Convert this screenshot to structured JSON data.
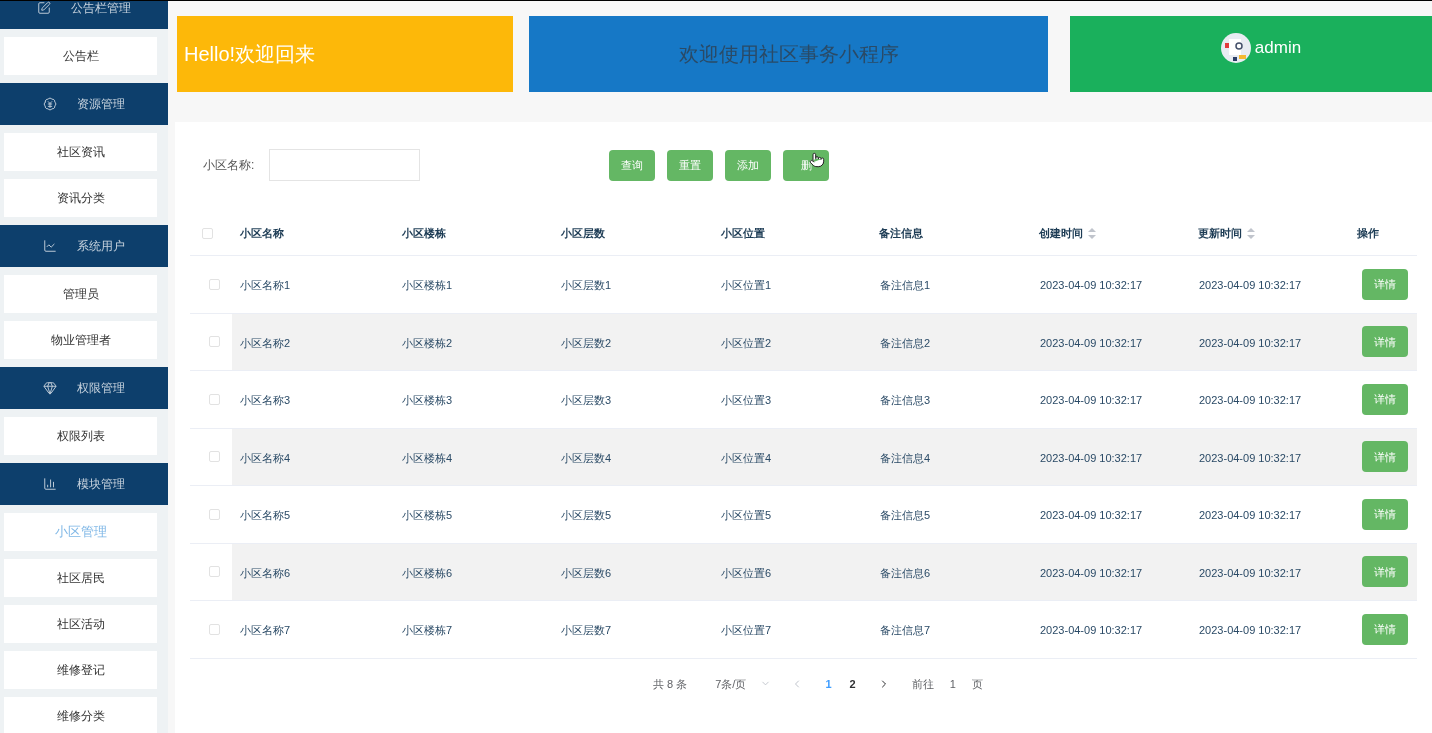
{
  "sidebar": {
    "groups": [
      {
        "title": "公告栏管理",
        "items": [
          {
            "label": "公告栏",
            "selected": false
          }
        ]
      },
      {
        "title": "资源管理",
        "items": [
          {
            "label": "社区资讯",
            "selected": false
          },
          {
            "label": "资讯分类",
            "selected": false
          }
        ]
      },
      {
        "title": "系统用户",
        "items": [
          {
            "label": "管理员",
            "selected": false
          },
          {
            "label": "物业管理者",
            "selected": false
          }
        ]
      },
      {
        "title": "权限管理",
        "items": [
          {
            "label": "权限列表",
            "selected": false
          }
        ]
      },
      {
        "title": "模块管理",
        "items": [
          {
            "label": "小区管理",
            "selected": true
          },
          {
            "label": "社区居民",
            "selected": false
          },
          {
            "label": "社区活动",
            "selected": false
          },
          {
            "label": "维修登记",
            "selected": false
          },
          {
            "label": "维修分类",
            "selected": false
          }
        ]
      }
    ]
  },
  "banners": {
    "greeting": "Hello!欢迎回来",
    "welcome": "欢迎使用社区事务小程序",
    "user": "admin"
  },
  "search": {
    "label": "小区名称:",
    "buttons": [
      "查询",
      "重置",
      "添加",
      "删"
    ]
  },
  "table": {
    "all_checked": false,
    "columns": [
      {
        "label": "小区名称",
        "sortable": false
      },
      {
        "label": "小区楼栋",
        "sortable": false
      },
      {
        "label": "小区层数",
        "sortable": false
      },
      {
        "label": "小区位置",
        "sortable": false
      },
      {
        "label": "备注信息",
        "sortable": false
      },
      {
        "label": "创建时间",
        "sortable": true
      },
      {
        "label": "更新时间",
        "sortable": true
      },
      {
        "label": "操作",
        "sortable": false
      }
    ],
    "rows": [
      {
        "cells": [
          "小区名称1",
          "小区楼栋1",
          "小区层数1",
          "小区位置1",
          "备注信息1",
          "2023-04-09 10:32:17",
          "2023-04-09 10:32:17"
        ],
        "action": "详情",
        "checked": false
      },
      {
        "cells": [
          "小区名称2",
          "小区楼栋2",
          "小区层数2",
          "小区位置2",
          "备注信息2",
          "2023-04-09 10:32:17",
          "2023-04-09 10:32:17"
        ],
        "action": "详情",
        "checked": false
      },
      {
        "cells": [
          "小区名称3",
          "小区楼栋3",
          "小区层数3",
          "小区位置3",
          "备注信息3",
          "2023-04-09 10:32:17",
          "2023-04-09 10:32:17"
        ],
        "action": "详情",
        "checked": false
      },
      {
        "cells": [
          "小区名称4",
          "小区楼栋4",
          "小区层数4",
          "小区位置4",
          "备注信息4",
          "2023-04-09 10:32:17",
          "2023-04-09 10:32:17"
        ],
        "action": "详情",
        "checked": false
      },
      {
        "cells": [
          "小区名称5",
          "小区楼栋5",
          "小区层数5",
          "小区位置5",
          "备注信息5",
          "2023-04-09 10:32:17",
          "2023-04-09 10:32:17"
        ],
        "action": "详情",
        "checked": false
      },
      {
        "cells": [
          "小区名称6",
          "小区楼栋6",
          "小区层数6",
          "小区位置6",
          "备注信息6",
          "2023-04-09 10:32:17",
          "2023-04-09 10:32:17"
        ],
        "action": "详情",
        "checked": false
      },
      {
        "cells": [
          "小区名称7",
          "小区楼栋7",
          "小区层数7",
          "小区位置7",
          "备注信息7",
          "2023-04-09 10:32:17",
          "2023-04-09 10:32:17"
        ],
        "action": "详情",
        "checked": false
      }
    ]
  },
  "pagination": {
    "total": "共 8 条",
    "page_size": "7条/页",
    "pages": [
      {
        "label": "1",
        "selected": true
      },
      {
        "label": "2",
        "selected": false
      }
    ],
    "goto_label": "前往",
    "goto_value": "1",
    "goto_suffix": "页"
  }
}
